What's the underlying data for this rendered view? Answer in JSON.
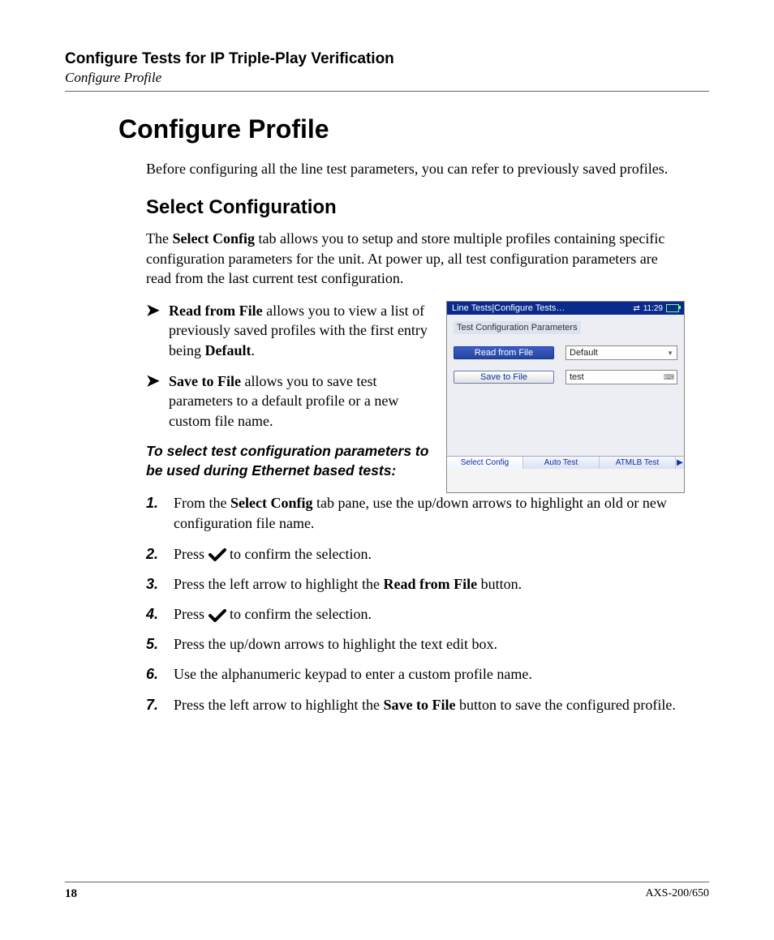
{
  "header": {
    "chapter": "Configure Tests for IP Triple-Play Verification",
    "breadcrumb": "Configure Profile"
  },
  "section": {
    "title": "Configure Profile",
    "intro": "Before configuring all the line test parameters, you can refer to previously saved profiles."
  },
  "subsection": {
    "title": "Select Configuration",
    "desc_pre": "The ",
    "desc_bold": "Select Config",
    "desc_post": " tab allows you to setup and store multiple profiles containing specific configuration parameters for the unit. At power up, all test configuration parameters are read from the last current test configuration."
  },
  "bullets": [
    {
      "label": "Read from File",
      "text_mid": " allows you to view a list of previously saved profiles with the first entry being ",
      "bold_tail": "Default",
      "tail_punct": "."
    },
    {
      "label": "Save to File",
      "text_mid": " allows you to save test parameters to a default profile or a new custom file name.",
      "bold_tail": "",
      "tail_punct": ""
    }
  ],
  "instr_lead": "To select test configuration parameters to be used during Ethernet based tests:",
  "steps": {
    "s1_pre": "From the ",
    "s1_bold": "Select Config",
    "s1_post": " tab pane, use the up/down arrows to highlight an old or new configuration file name.",
    "s2_pre": "Press ",
    "s2_post": " to confirm the selection.",
    "s3_pre": "Press the left arrow to highlight the ",
    "s3_bold": "Read from File",
    "s3_post": " button.",
    "s4_pre": "Press ",
    "s4_post": " to confirm the selection.",
    "s5": "Press the up/down arrows to highlight the text edit box.",
    "s6": "Use the alphanumeric keypad to enter a custom profile name.",
    "s7_pre": "Press the left arrow to highlight the ",
    "s7_bold": "Save to File",
    "s7_post": " button to save the configured profile."
  },
  "screenshot": {
    "title": "Line Tests|Configure Tests…",
    "clock": "11:29",
    "caption": "Test Configuration Parameters",
    "btn_read": "Read from File",
    "btn_save": "Save to File",
    "field_default": "Default",
    "field_test": "test",
    "tabs": [
      "Select Config",
      "Auto Test",
      "ATMLB Test"
    ]
  },
  "footer": {
    "page": "18",
    "model": "AXS-200/650"
  }
}
